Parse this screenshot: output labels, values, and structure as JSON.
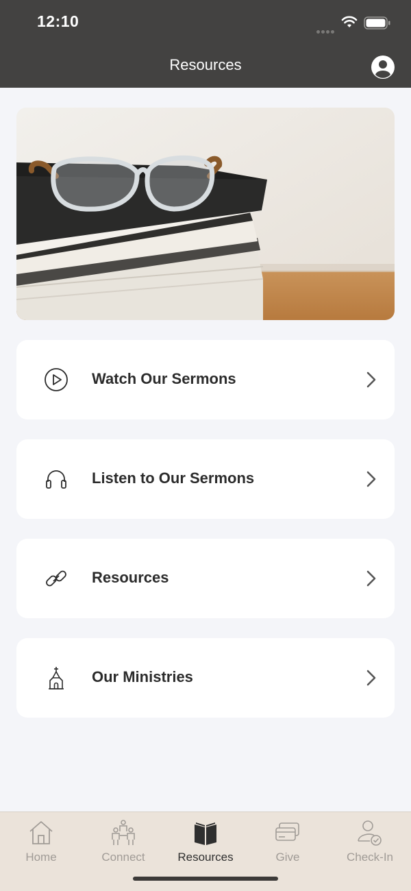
{
  "status_bar": {
    "time": "12:10"
  },
  "header": {
    "title": "Resources"
  },
  "menu": [
    {
      "label": "Watch Our Sermons",
      "icon": "play-circle-icon"
    },
    {
      "label": "Listen to Our Sermons",
      "icon": "headphones-icon"
    },
    {
      "label": "Resources",
      "icon": "link-icon"
    },
    {
      "label": "Our Ministries",
      "icon": "church-icon"
    }
  ],
  "tabs": [
    {
      "label": "Home",
      "icon": "home-icon",
      "active": false
    },
    {
      "label": "Connect",
      "icon": "people-icon",
      "active": false
    },
    {
      "label": "Resources",
      "icon": "book-icon",
      "active": true
    },
    {
      "label": "Give",
      "icon": "card-icon",
      "active": false
    },
    {
      "label": "Check-In",
      "icon": "person-check-icon",
      "active": false
    }
  ],
  "colors": {
    "header_bg": "#434241",
    "page_bg": "#f4f5f9",
    "tabbar_bg": "#ebe3da",
    "active_tab": "#2f2f2f",
    "inactive_tab": "#a09b96"
  }
}
